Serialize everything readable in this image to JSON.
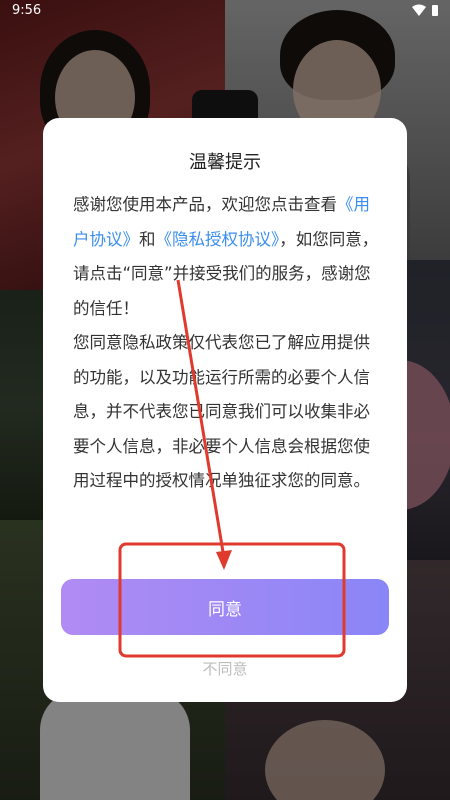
{
  "status_bar": {
    "time": "9:56"
  },
  "dialog": {
    "title": "温馨提示",
    "body": {
      "intro": "感谢您使用本产品，欢迎您点击查看",
      "user_agreement_link": "《用户协议》",
      "and": "和",
      "privacy_link": "《隐私授权协议》",
      "rest": "，如您同意，请点击“同意”并接受我们的服务，感谢您的信任！",
      "para2": "您同意隐私政策仅代表您已了解应用提供的功能，以及功能运行所需的必要个人信息，并不代表您已同意我们可以收集非必要个人信息，非必要个人信息会根据您使用过程中的授权情况单独征求您的同意。"
    },
    "agree_label": "同意",
    "disagree_label": "不同意"
  },
  "colors": {
    "link": "#3b8ef0",
    "button_gradient_start": "#b18bf3",
    "button_gradient_end": "#8a86f7",
    "annotation": "#e03a2f"
  }
}
